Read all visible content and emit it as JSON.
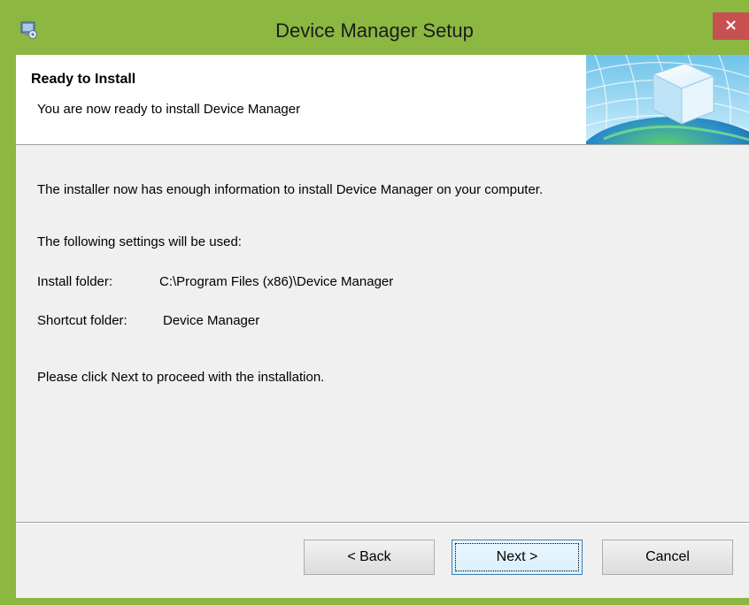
{
  "window": {
    "title": "Device Manager Setup",
    "close_glyph": "×",
    "titlebar_color": "#8cb741",
    "close_color": "#c75050"
  },
  "header": {
    "title": "Ready to Install",
    "subtitle": "You are now ready to install Device Manager"
  },
  "content": {
    "intro": "The installer now has enough information to install Device Manager on your computer.",
    "settings_heading": "The following settings will be used:",
    "install_folder_label": "Install folder:",
    "install_folder_value": "C:\\Program Files (x86)\\Device Manager",
    "shortcut_folder_label": "Shortcut folder:",
    "shortcut_folder_value": "Device Manager",
    "instruction": "Please click Next to proceed with the installation."
  },
  "buttons": {
    "back_label": "< Back",
    "next_label": "Next >",
    "cancel_label": "Cancel"
  },
  "icons": {
    "app": "setup-app-icon",
    "banner": "globe-cube-banner-icon"
  }
}
